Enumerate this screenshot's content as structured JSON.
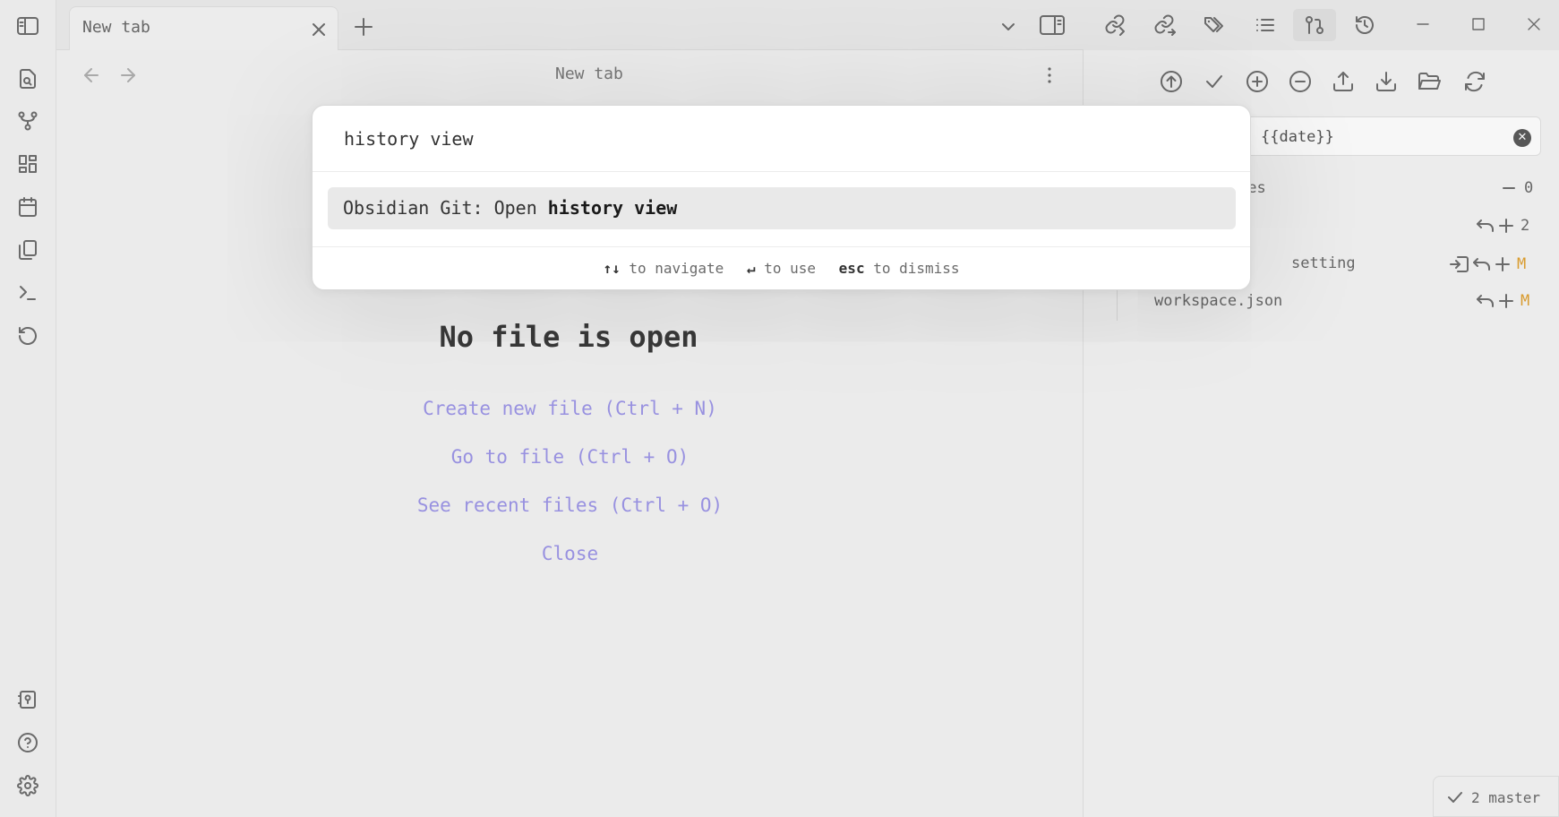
{
  "tab": {
    "title": "New tab"
  },
  "main": {
    "title": "New tab",
    "empty_title": "No file is open",
    "links": [
      "Create new file (Ctrl + N)",
      "Go to file (Ctrl + O)",
      "See recent files (Ctrl + O)",
      "Close"
    ]
  },
  "git_panel": {
    "commit_message": "{{date}}",
    "rows": [
      {
        "label": "ges",
        "count": "0"
      },
      {
        "label": "",
        "count": "2"
      },
      {
        "label": "setting",
        "status": "M"
      },
      {
        "label": "workspace.json",
        "status": "M"
      }
    ],
    "status_bar": "2 master"
  },
  "palette": {
    "query": "history view",
    "result_prefix": "Obsidian Git: Open ",
    "result_match": "history view",
    "hint_navigate_key": "↑↓",
    "hint_navigate": "to navigate",
    "hint_use_key": "↵",
    "hint_use": "to use",
    "hint_dismiss_key": "esc",
    "hint_dismiss": "to dismiss"
  },
  "icons": {
    "accent": "#9d96e8",
    "modified": "#e0a030"
  }
}
